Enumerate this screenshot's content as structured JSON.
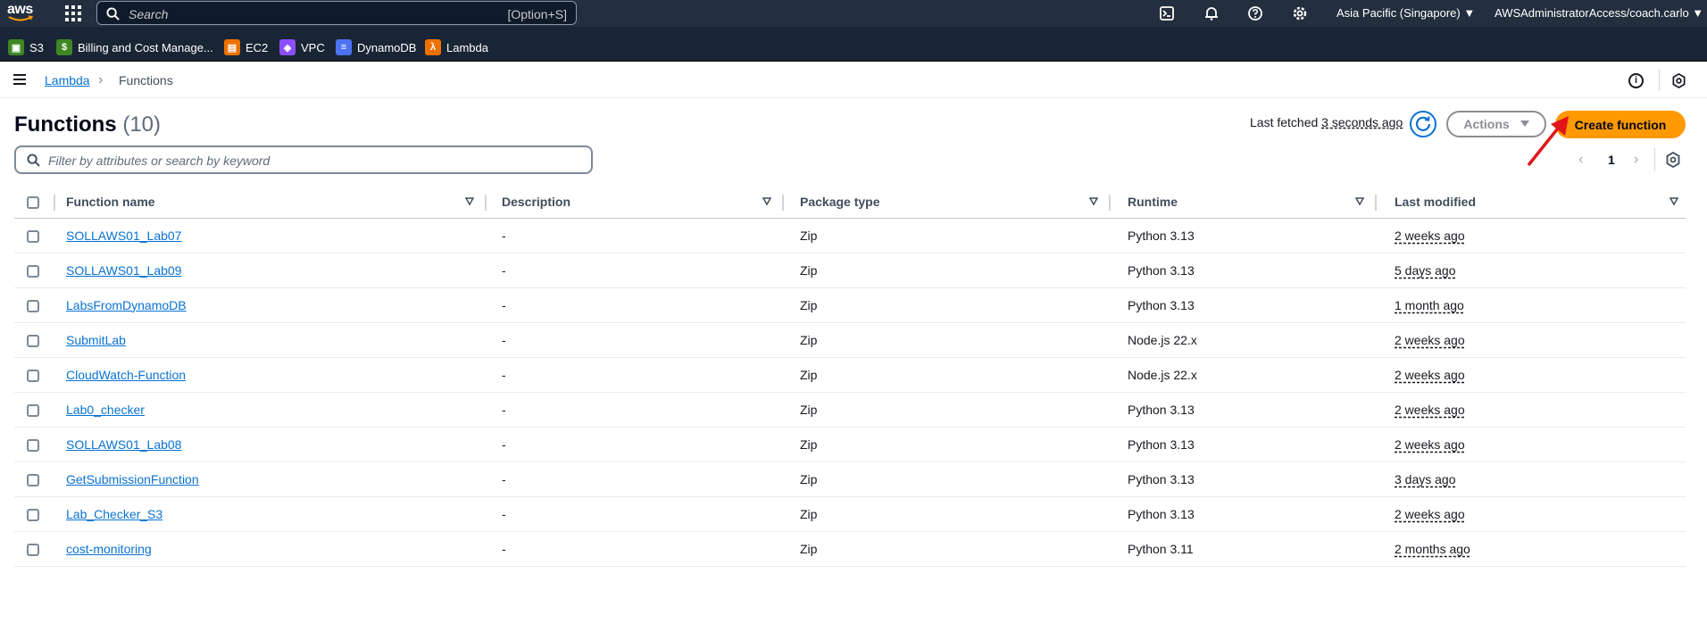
{
  "topnav": {
    "logo_text": "aws",
    "search_placeholder": "Search",
    "search_shortcut": "[Option+S]",
    "region": "Asia Pacific (Singapore) ▼",
    "account": "AWSAdministratorAccess/coach.carlo ▼"
  },
  "favorites": [
    {
      "label": "S3",
      "color": "#3f8624"
    },
    {
      "label": "Billing and Cost Manage...",
      "color": "#3f8624"
    },
    {
      "label": "EC2",
      "color": "#ed7100"
    },
    {
      "label": "VPC",
      "color": "#8c4fff"
    },
    {
      "label": "DynamoDB",
      "color": "#4d72f3"
    },
    {
      "label": "Lambda",
      "color": "#ed7100"
    }
  ],
  "breadcrumb": {
    "root": "Lambda",
    "current": "Functions"
  },
  "header": {
    "title": "Functions",
    "count": "(10)",
    "fetched_label": "Last fetched",
    "fetched_ago": "3 seconds ago",
    "actions_label": "Actions",
    "create_label": "Create function"
  },
  "filter": {
    "placeholder": "Filter by attributes or search by keyword"
  },
  "pagination": {
    "current_page": "1"
  },
  "table": {
    "columns": [
      "Function name",
      "Description",
      "Package type",
      "Runtime",
      "Last modified"
    ],
    "rows": [
      {
        "name": "SOLLAWS01_Lab07",
        "description": "-",
        "package": "Zip",
        "runtime": "Python 3.13",
        "modified": "2 weeks ago"
      },
      {
        "name": "SOLLAWS01_Lab09",
        "description": "-",
        "package": "Zip",
        "runtime": "Python 3.13",
        "modified": "5 days ago"
      },
      {
        "name": "LabsFromDynamoDB",
        "description": "-",
        "package": "Zip",
        "runtime": "Python 3.13",
        "modified": "1 month ago"
      },
      {
        "name": "SubmitLab",
        "description": "-",
        "package": "Zip",
        "runtime": "Node.js 22.x",
        "modified": "2 weeks ago"
      },
      {
        "name": "CloudWatch-Function",
        "description": "-",
        "package": "Zip",
        "runtime": "Node.js 22.x",
        "modified": "2 weeks ago"
      },
      {
        "name": "Lab0_checker",
        "description": "-",
        "package": "Zip",
        "runtime": "Python 3.13",
        "modified": "2 weeks ago"
      },
      {
        "name": "SOLLAWS01_Lab08",
        "description": "-",
        "package": "Zip",
        "runtime": "Python 3.13",
        "modified": "2 weeks ago"
      },
      {
        "name": "GetSubmissionFunction",
        "description": "-",
        "package": "Zip",
        "runtime": "Python 3.13",
        "modified": "3 days ago"
      },
      {
        "name": "Lab_Checker_S3",
        "description": "-",
        "package": "Zip",
        "runtime": "Python 3.13",
        "modified": "2 weeks ago"
      },
      {
        "name": "cost-monitoring",
        "description": "-",
        "package": "Zip",
        "runtime": "Python 3.11",
        "modified": "2 months ago"
      }
    ]
  },
  "colors": {
    "nav_bg": "#232f3e",
    "fav_bg": "#192534",
    "link": "#0972d3",
    "primary_button": "#ff9900",
    "annotation_arrow": "#e0161b"
  }
}
